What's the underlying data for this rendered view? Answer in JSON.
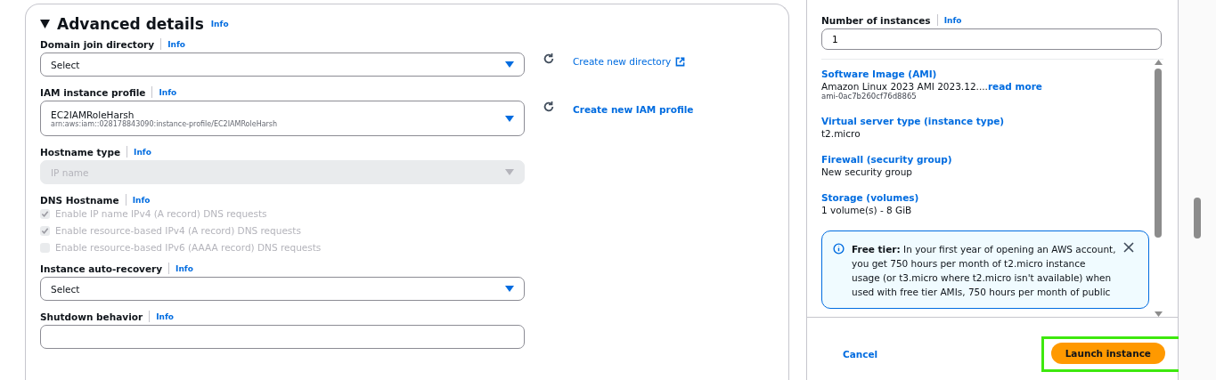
{
  "advanced": {
    "title": "Advanced details",
    "expanded": true,
    "info": "Info",
    "fields": [
      {
        "kind": "select",
        "label": "Domain join directory",
        "info": "Info",
        "value": "Select",
        "disabled": false,
        "link": {
          "text": "Create new directory",
          "bold": false,
          "external": true
        }
      },
      {
        "kind": "select",
        "label": "IAM instance profile",
        "info": "Info",
        "value": "EC2IAMRoleHarsh",
        "description": "arn:aws:iam::028178843090:instance-profile/EC2IAMRoleHarsh",
        "disabled": false,
        "link": {
          "text": "Create new IAM profile",
          "bold": true,
          "external": false
        }
      },
      {
        "kind": "select",
        "label": "Hostname type",
        "info": "Info",
        "value": "IP name",
        "disabled": true
      },
      {
        "kind": "checkboxes",
        "label": "DNS Hostname",
        "info": "Info",
        "options": [
          {
            "text": "Enable IP name IPv4 (A record) DNS requests",
            "checked": true,
            "disabled": true
          },
          {
            "text": "Enable resource-based IPv4 (A record) DNS requests",
            "checked": true,
            "disabled": true
          },
          {
            "text": "Enable resource-based IPv6 (AAAA record) DNS requests",
            "checked": false,
            "disabled": true
          }
        ]
      },
      {
        "kind": "select",
        "label": "Instance auto-recovery",
        "info": "Info",
        "value": "Select",
        "disabled": false
      },
      {
        "kind": "select",
        "label": "Shutdown behavior",
        "info": "Info",
        "disabled": false
      }
    ]
  },
  "summary": {
    "instances_label": "Number of instances",
    "info": "Info",
    "instances_value": "1",
    "items": [
      {
        "title": "Software Image (AMI)",
        "value": "Amazon Linux 2023 AMI 2023.12....",
        "more": "read more",
        "sub": "ami-0ac7b260cf76d8865"
      },
      {
        "title": "Virtual server type (instance type)",
        "value": "t2.micro"
      },
      {
        "title": "Firewall (security group)",
        "value": "New security group"
      },
      {
        "title": "Storage (volumes)",
        "value": "1 volume(s) - 8 GiB"
      }
    ],
    "alert": {
      "text": "**Free tier:** In your first year of opening an AWS account, you get 750 hours per month of t2.micro instance usage (or t3.micro where t2.micro isn't available) when used with free tier AMIs, 750 hours per month of public"
    },
    "cancel": "Cancel",
    "launch": "Launch instance",
    "launch_highlighted": true
  }
}
